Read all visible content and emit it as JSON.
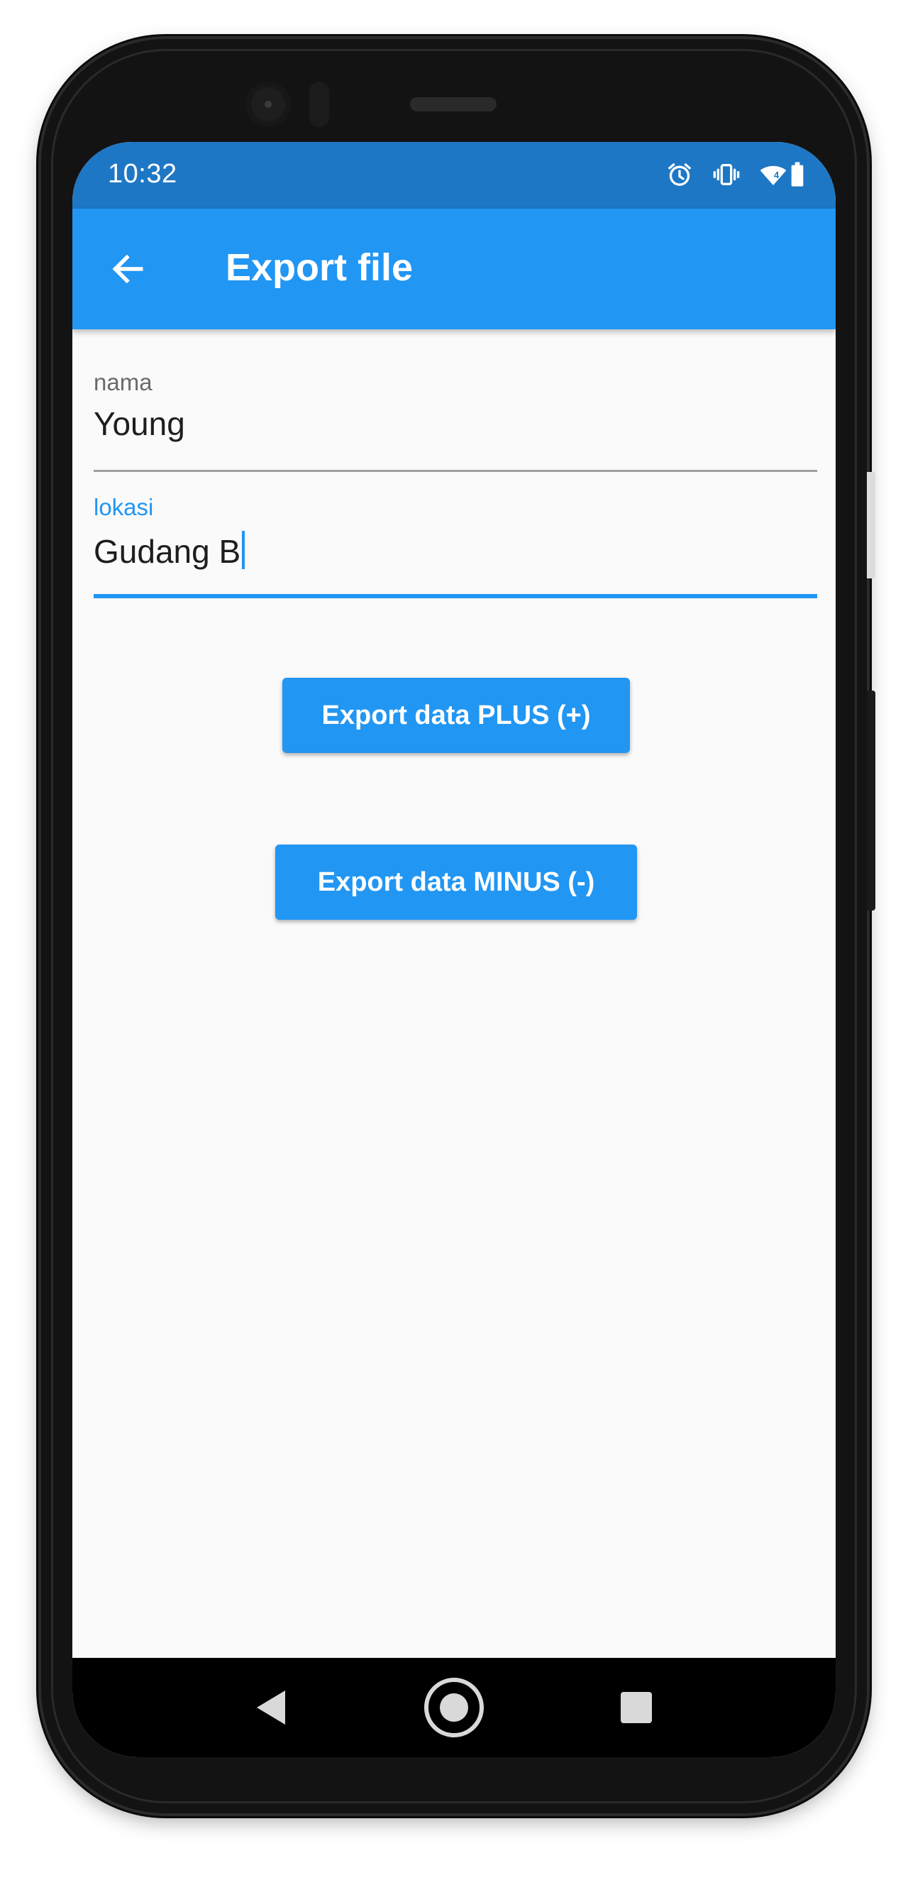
{
  "status_bar": {
    "time": "10:32",
    "icons": [
      "alarm-icon",
      "vibrate-icon",
      "wifi-icon",
      "battery-icon"
    ]
  },
  "app_bar": {
    "back_icon": "arrow-back-icon",
    "title": "Export file"
  },
  "form": {
    "nama": {
      "label": "nama",
      "value": "Young"
    },
    "lokasi": {
      "label": "lokasi",
      "value": "Gudang B",
      "focused": true
    }
  },
  "buttons": {
    "export_plus": "Export data PLUS (+)",
    "export_minus": "Export data MINUS (-)"
  },
  "nav_bar": {
    "items": [
      "back-triangle-icon",
      "home-circle-icon",
      "recents-square-icon"
    ]
  },
  "colors": {
    "status_bar": "#1e77c4",
    "app_bar": "#2196f3",
    "accent": "#2196f3",
    "background": "#fafafa"
  }
}
